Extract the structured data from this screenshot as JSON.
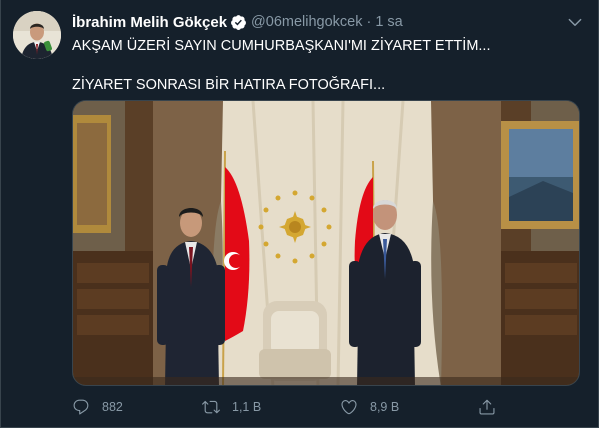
{
  "tweet": {
    "author_name": "İbrahim Melih Gökçek",
    "handle": "@06melihgokcek",
    "separator": "·",
    "time": "1 sa",
    "text_line_1": "AKŞAM ÜZERİ SAYIN CUMHURBAŞKANI'MI ZİYARET ETTİM...",
    "text_line_2": "ZİYARET SONRASI BİR HATIRA FOTOĞRAFI...",
    "replies": "882",
    "retweets": "1,1 B",
    "likes": "8,9 B"
  },
  "icons": {
    "verified": "verified-badge-icon",
    "more": "chevron-down-icon",
    "reply": "reply-icon",
    "retweet": "retweet-icon",
    "like": "heart-icon",
    "share": "share-icon"
  },
  "colors": {
    "background": "#15202b",
    "border": "#38444d",
    "secondary_text": "#8899a6",
    "verified_blue": "#ffffff",
    "flag_red": "#e30a17"
  }
}
